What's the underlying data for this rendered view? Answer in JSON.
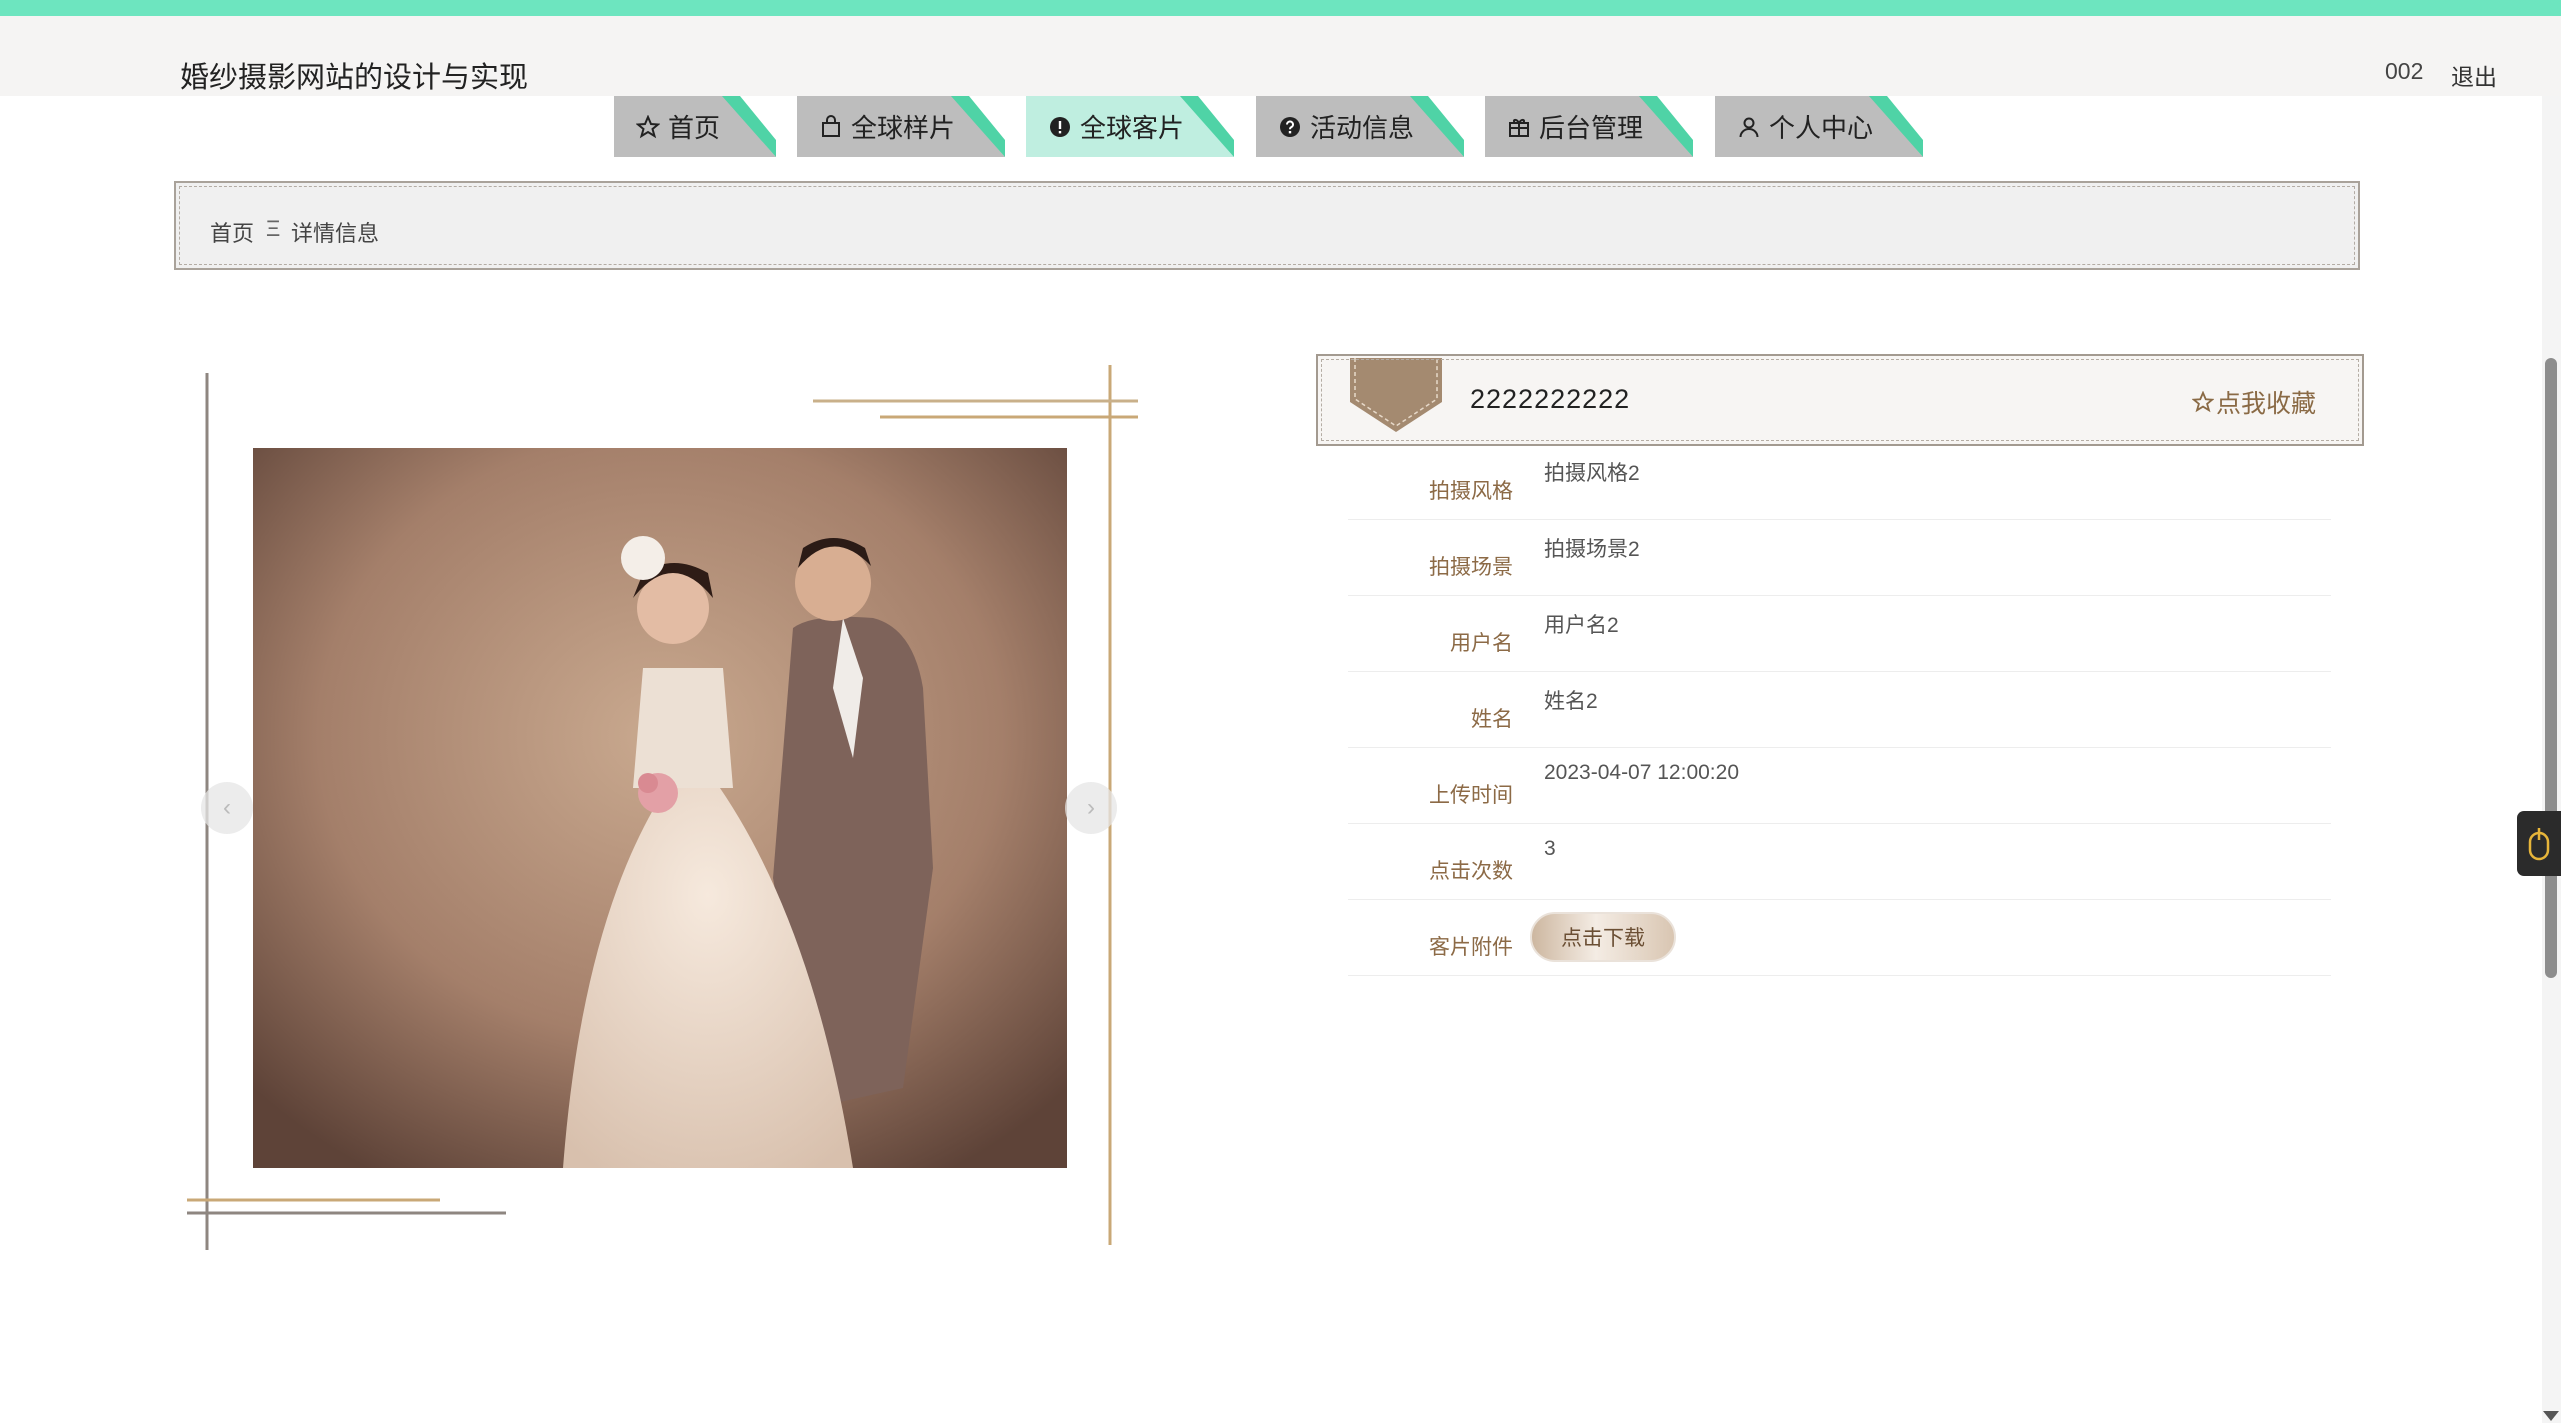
{
  "header": {
    "title": "婚纱摄影网站的设计与实现",
    "username": "002",
    "logout_label": "退出"
  },
  "nav": {
    "items": [
      {
        "label": "首页",
        "icon": "star-icon",
        "active": false
      },
      {
        "label": "全球样片",
        "icon": "bag-icon",
        "active": false
      },
      {
        "label": "全球客片",
        "icon": "alert-icon",
        "active": true
      },
      {
        "label": "活动信息",
        "icon": "question-icon",
        "active": false
      },
      {
        "label": "后台管理",
        "icon": "gift-icon",
        "active": false
      },
      {
        "label": "个人中心",
        "icon": "user-icon",
        "active": false
      }
    ]
  },
  "breadcrumb": {
    "home": "首页",
    "separator": "Ξ",
    "current": "详情信息"
  },
  "gallery": {
    "prev_arrow": "‹",
    "next_arrow": "›"
  },
  "detail": {
    "title": "2222222222",
    "favorite_label": "点我收藏",
    "fields": [
      {
        "label": "拍摄风格",
        "value": "拍摄风格2"
      },
      {
        "label": "拍摄场景",
        "value": "拍摄场景2"
      },
      {
        "label": "用户名",
        "value": "用户名2"
      },
      {
        "label": "姓名",
        "value": "姓名2"
      },
      {
        "label": "上传时间",
        "value": "2023-04-07 12:00:20"
      },
      {
        "label": "点击次数",
        "value": "3"
      }
    ],
    "attachment_label": "客片附件",
    "download_label": "点击下载"
  },
  "colors": {
    "topbar": "#6de5bf",
    "tab_inactive": "#bdbdbd",
    "tab_active": "#bfeee0",
    "tab_accent": "#4fd3a6",
    "label_brown": "#8c6a46"
  }
}
